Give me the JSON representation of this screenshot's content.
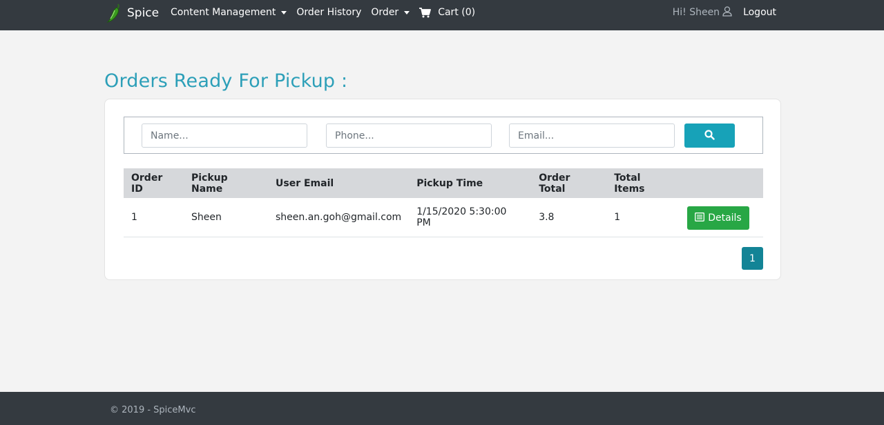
{
  "navbar": {
    "brand": "Spice",
    "items": [
      {
        "label": "Content Management",
        "dropdown": true
      },
      {
        "label": "Order History",
        "dropdown": false
      },
      {
        "label": "Order",
        "dropdown": true
      }
    ],
    "cart_label": "Cart (0)",
    "greeting": "Hi! Sheen",
    "logout_label": "Logout"
  },
  "page": {
    "title": "Orders Ready For Pickup :"
  },
  "search": {
    "name_placeholder": "Name...",
    "phone_placeholder": "Phone...",
    "email_placeholder": "Email..."
  },
  "table": {
    "headers": [
      "Order ID",
      "Pickup Name",
      "User Email",
      "Pickup Time",
      "Order Total",
      "Total Items"
    ],
    "rows": [
      {
        "order_id": "1",
        "pickup_name": "Sheen",
        "user_email": "sheen.an.goh@gmail.com",
        "pickup_time": "1/15/2020 5:30:00 PM",
        "order_total": "3.8",
        "total_items": "1",
        "action_label": "Details"
      }
    ]
  },
  "pagination": {
    "current_page": "1"
  },
  "footer": {
    "text": "© 2019 - SpiceMvc"
  },
  "colors": {
    "navbar_bg": "#343a40",
    "title": "#2c9fb8",
    "search_button": "#17a2b8",
    "details_button": "#28a745",
    "pager_active": "#138496"
  },
  "icons": {
    "brand": "chili-pepper-icon",
    "cart": "shopping-cart-icon",
    "user": "user-icon",
    "search": "search-icon",
    "details": "list-icon"
  }
}
